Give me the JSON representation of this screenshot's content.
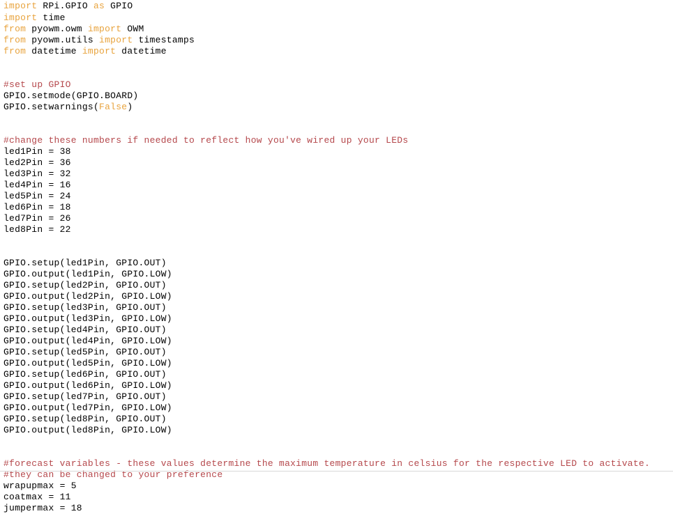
{
  "editor": {
    "language": "Python",
    "background_color": "#ffffff",
    "keyword_color": "#e8a33d",
    "comment_color": "#b5484c",
    "text_color": "#000000"
  },
  "code": {
    "lines": [
      {
        "id": "line-1",
        "tokens": [
          {
            "t": "import",
            "c": "kw"
          },
          {
            "t": " RPi.GPIO ",
            "c": "plain"
          },
          {
            "t": "as",
            "c": "kw"
          },
          {
            "t": " GPIO",
            "c": "plain"
          }
        ]
      },
      {
        "id": "line-2",
        "tokens": [
          {
            "t": "import",
            "c": "kw"
          },
          {
            "t": " time",
            "c": "plain"
          }
        ]
      },
      {
        "id": "line-3",
        "tokens": [
          {
            "t": "from",
            "c": "kw"
          },
          {
            "t": " pyowm.owm ",
            "c": "plain"
          },
          {
            "t": "import",
            "c": "kw"
          },
          {
            "t": " OWM",
            "c": "plain"
          }
        ]
      },
      {
        "id": "line-4",
        "tokens": [
          {
            "t": "from",
            "c": "kw"
          },
          {
            "t": " pyowm.utils ",
            "c": "plain"
          },
          {
            "t": "import",
            "c": "kw"
          },
          {
            "t": " timestamps",
            "c": "plain"
          }
        ]
      },
      {
        "id": "line-5",
        "tokens": [
          {
            "t": "from",
            "c": "kw"
          },
          {
            "t": " datetime ",
            "c": "plain"
          },
          {
            "t": "import",
            "c": "kw"
          },
          {
            "t": " datetime",
            "c": "plain"
          }
        ]
      },
      {
        "id": "line-6",
        "tokens": []
      },
      {
        "id": "line-7",
        "tokens": []
      },
      {
        "id": "line-8",
        "tokens": [
          {
            "t": "#set up GPIO",
            "c": "comment"
          }
        ]
      },
      {
        "id": "line-9",
        "tokens": [
          {
            "t": "GPIO.setmode(GPIO.BOARD)",
            "c": "plain"
          }
        ]
      },
      {
        "id": "line-10",
        "tokens": [
          {
            "t": "GPIO.setwarnings(",
            "c": "plain"
          },
          {
            "t": "False",
            "c": "kw"
          },
          {
            "t": ")",
            "c": "plain"
          }
        ]
      },
      {
        "id": "line-11",
        "tokens": []
      },
      {
        "id": "line-12",
        "tokens": []
      },
      {
        "id": "line-13",
        "tokens": [
          {
            "t": "#change these numbers if needed to reflect how you've wired up your LEDs",
            "c": "comment"
          }
        ]
      },
      {
        "id": "line-14",
        "tokens": [
          {
            "t": "led1Pin = 38",
            "c": "plain"
          }
        ]
      },
      {
        "id": "line-15",
        "tokens": [
          {
            "t": "led2Pin = 36",
            "c": "plain"
          }
        ]
      },
      {
        "id": "line-16",
        "tokens": [
          {
            "t": "led3Pin = 32",
            "c": "plain"
          }
        ]
      },
      {
        "id": "line-17",
        "tokens": [
          {
            "t": "led4Pin = 16",
            "c": "plain"
          }
        ]
      },
      {
        "id": "line-18",
        "tokens": [
          {
            "t": "led5Pin = 24",
            "c": "plain"
          }
        ]
      },
      {
        "id": "line-19",
        "tokens": [
          {
            "t": "led6Pin = 18",
            "c": "plain"
          }
        ]
      },
      {
        "id": "line-20",
        "tokens": [
          {
            "t": "led7Pin = 26",
            "c": "plain"
          }
        ]
      },
      {
        "id": "line-21",
        "tokens": [
          {
            "t": "led8Pin = 22",
            "c": "plain"
          }
        ]
      },
      {
        "id": "line-22",
        "tokens": []
      },
      {
        "id": "line-23",
        "tokens": []
      },
      {
        "id": "line-24",
        "tokens": [
          {
            "t": "GPIO.setup(led1Pin, GPIO.OUT)",
            "c": "plain"
          }
        ]
      },
      {
        "id": "line-25",
        "tokens": [
          {
            "t": "GPIO.output(led1Pin, GPIO.LOW)",
            "c": "plain"
          }
        ]
      },
      {
        "id": "line-26",
        "tokens": [
          {
            "t": "GPIO.setup(led2Pin, GPIO.OUT)",
            "c": "plain"
          }
        ]
      },
      {
        "id": "line-27",
        "tokens": [
          {
            "t": "GPIO.output(led2Pin, GPIO.LOW)",
            "c": "plain"
          }
        ]
      },
      {
        "id": "line-28",
        "tokens": [
          {
            "t": "GPIO.setup(led3Pin, GPIO.OUT)",
            "c": "plain"
          }
        ]
      },
      {
        "id": "line-29",
        "tokens": [
          {
            "t": "GPIO.output(led3Pin, GPIO.LOW)",
            "c": "plain"
          }
        ]
      },
      {
        "id": "line-30",
        "tokens": [
          {
            "t": "GPIO.setup(led4Pin, GPIO.OUT)",
            "c": "plain"
          }
        ]
      },
      {
        "id": "line-31",
        "tokens": [
          {
            "t": "GPIO.output(led4Pin, GPIO.LOW)",
            "c": "plain"
          }
        ]
      },
      {
        "id": "line-32",
        "tokens": [
          {
            "t": "GPIO.setup(led5Pin, GPIO.OUT)",
            "c": "plain"
          }
        ]
      },
      {
        "id": "line-33",
        "tokens": [
          {
            "t": "GPIO.output(led5Pin, GPIO.LOW)",
            "c": "plain"
          }
        ]
      },
      {
        "id": "line-34",
        "tokens": [
          {
            "t": "GPIO.setup(led6Pin, GPIO.OUT)",
            "c": "plain"
          }
        ]
      },
      {
        "id": "line-35",
        "tokens": [
          {
            "t": "GPIO.output(led6Pin, GPIO.LOW)",
            "c": "plain"
          }
        ]
      },
      {
        "id": "line-36",
        "tokens": [
          {
            "t": "GPIO.setup(led7Pin, GPIO.OUT)",
            "c": "plain"
          }
        ]
      },
      {
        "id": "line-37",
        "tokens": [
          {
            "t": "GPIO.output(led7Pin, GPIO.LOW)",
            "c": "plain"
          }
        ]
      },
      {
        "id": "line-38",
        "tokens": [
          {
            "t": "GPIO.setup(led8Pin, GPIO.OUT)",
            "c": "plain"
          }
        ]
      },
      {
        "id": "line-39",
        "tokens": [
          {
            "t": "GPIO.output(led8Pin, GPIO.LOW)",
            "c": "plain"
          }
        ]
      },
      {
        "id": "line-40",
        "tokens": []
      },
      {
        "id": "line-41",
        "tokens": []
      },
      {
        "id": "line-42",
        "tokens": [
          {
            "t": "#forecast variables - these values determine the maximum temperature in celsius for the respective LED to activate.",
            "c": "comment"
          }
        ]
      },
      {
        "id": "line-43",
        "tokens": [
          {
            "t": "#they can be changed to your preference",
            "c": "comment"
          }
        ]
      },
      {
        "id": "line-44",
        "tokens": [
          {
            "t": "wrapupmax = 5",
            "c": "plain"
          }
        ]
      },
      {
        "id": "line-45",
        "tokens": [
          {
            "t": "coatmax = 11",
            "c": "plain"
          }
        ]
      },
      {
        "id": "line-46",
        "tokens": [
          {
            "t": "jumpermax = 18",
            "c": "plain"
          }
        ]
      }
    ]
  }
}
